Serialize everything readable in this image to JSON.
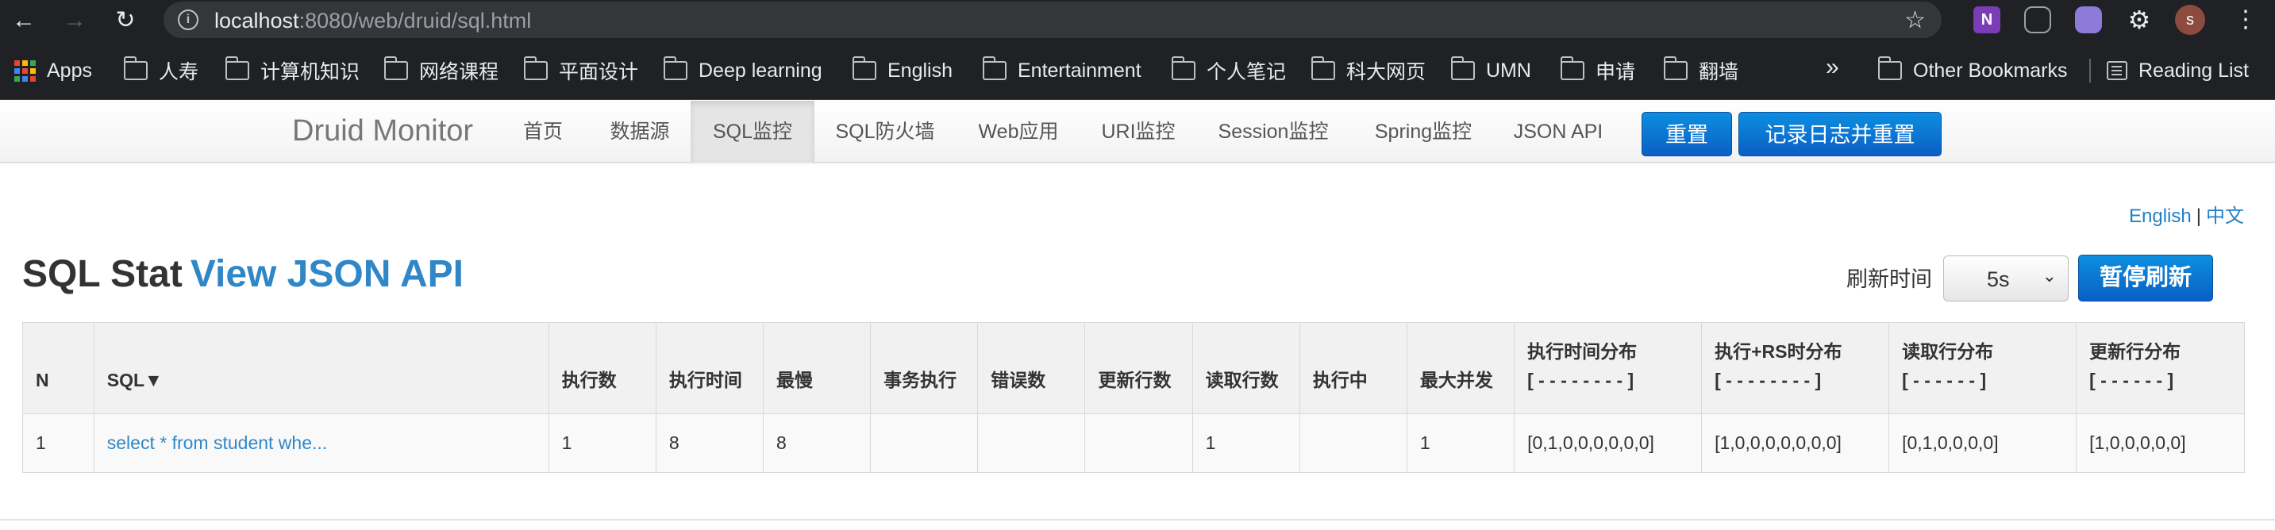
{
  "browser": {
    "url_host": "localhost",
    "url_rest": ":8080/web/druid/sql.html",
    "profile_initial": "s",
    "bookmarks": [
      "Apps",
      "人寿",
      "计算机知识",
      "网络课程",
      "平面设计",
      "Deep learning",
      "English",
      "Entertainment",
      "个人笔记",
      "科大网页",
      "UMN",
      "申请",
      "翻墙"
    ],
    "more_label": "»",
    "other_bookmarks": "Other Bookmarks",
    "reading_list": "Reading List"
  },
  "nav": {
    "brand": "Druid Monitor",
    "items": [
      "首页",
      "数据源",
      "SQL监控",
      "SQL防火墙",
      "Web应用",
      "URI监控",
      "Session监控",
      "Spring监控",
      "JSON API"
    ],
    "active_index": 2,
    "reset_label": "重置",
    "log_reset_label": "记录日志并重置"
  },
  "lang": {
    "english": "English",
    "separator": "|",
    "chinese": "中文"
  },
  "page": {
    "title": "SQL Stat",
    "json_link": "View JSON API",
    "refresh_label": "刷新时间",
    "refresh_value": "5s",
    "refresh_options": [
      "5s"
    ],
    "pause_label": "暂停刷新"
  },
  "table": {
    "headers": [
      "N",
      "SQL▼",
      "执行数",
      "执行时间",
      "最慢",
      "事务执行",
      "错误数",
      "更新行数",
      "读取行数",
      "执行中",
      "最大并发",
      "执行时间分布",
      "执行+RS时分布",
      "读取行分布",
      "更新行分布"
    ],
    "header_sublines": {
      "11": "[ - - - - - - - - ]",
      "12": "[ - - - - - - - - ]",
      "13": "[ - - - - - - ]",
      "14": "[ - - - - - - ]"
    },
    "rows": [
      [
        "1",
        "select * from student whe...",
        "1",
        "8",
        "8",
        "",
        "",
        "",
        "1",
        "",
        "1",
        "[0,1,0,0,0,0,0,0]",
        "[1,0,0,0,0,0,0,0]",
        "[0,1,0,0,0,0]",
        "[1,0,0,0,0,0]"
      ]
    ]
  },
  "colors": {
    "chrome_bg": "#202124",
    "link_blue": "#2f87c8",
    "button_blue": "#0a5fc4"
  }
}
